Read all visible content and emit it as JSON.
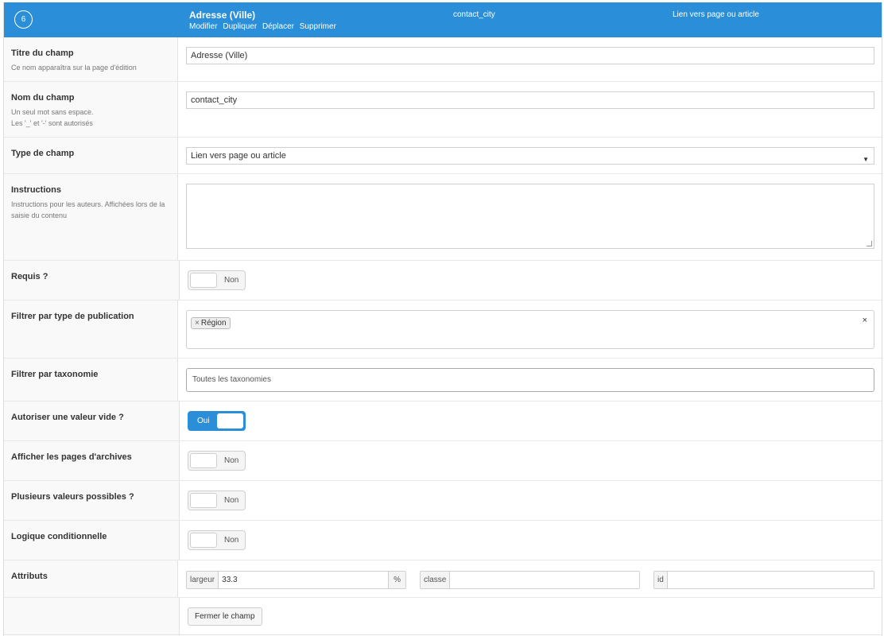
{
  "header": {
    "order": "6",
    "label": "Adresse (Ville)",
    "actions": [
      "Modifier",
      "Dupliquer",
      "Déplacer",
      "Supprimer"
    ],
    "name": "contact_city",
    "type": "Lien vers page ou article"
  },
  "rows": {
    "title": {
      "label": "Titre du champ",
      "desc": "Ce nom apparaîtra sur la page d'édition",
      "value": "Adresse (Ville)"
    },
    "name": {
      "label": "Nom du champ",
      "desc1": "Un seul mot sans espace.",
      "desc2": "Les '_' et '-' sont autorisés",
      "value": "contact_city"
    },
    "type": {
      "label": "Type de champ",
      "value": "Lien vers page ou article"
    },
    "instructions": {
      "label": "Instructions",
      "desc": "Instructions pour les auteurs. Affichées lors de la saisie du contenu",
      "value": ""
    },
    "required": {
      "label": "Requis ?",
      "toggle": "Non"
    },
    "post_type": {
      "label": "Filtrer par type de publication",
      "chip": "Région",
      "chip_remove": "×",
      "clear": "×"
    },
    "taxonomy": {
      "label": "Filtrer par taxonomie",
      "placeholder": "Toutes les taxonomies"
    },
    "allow_null": {
      "label": "Autoriser une valeur vide ?",
      "toggle": "Oui"
    },
    "archives": {
      "label": "Afficher les pages d'archives",
      "toggle": "Non"
    },
    "multiple": {
      "label": "Plusieurs valeurs possibles ?",
      "toggle": "Non"
    },
    "conditional": {
      "label": "Logique conditionnelle",
      "toggle": "Non"
    },
    "attributes": {
      "label": "Attributs",
      "width_label": "largeur",
      "width_value": "33.3",
      "width_unit": "%",
      "class_label": "classe",
      "class_value": "",
      "id_label": "id",
      "id_value": ""
    }
  },
  "footer": {
    "close_button": "Fermer le champ"
  },
  "colors": {
    "accent": "#2a8fd8"
  }
}
